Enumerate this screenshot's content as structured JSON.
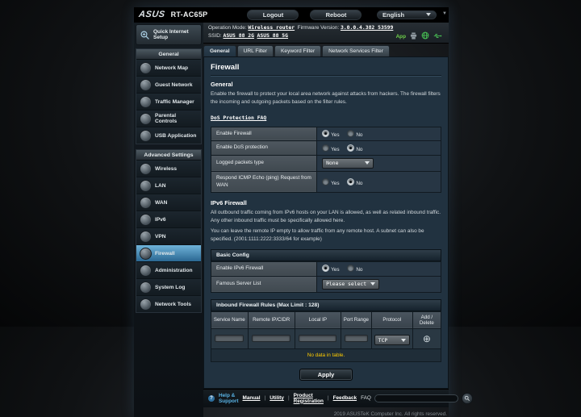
{
  "header": {
    "brand": "ASUS",
    "model": "RT-AC65P",
    "logout": "Logout",
    "reboot": "Reboot",
    "language": "English"
  },
  "infobar": {
    "operation_mode_label": "Operation Mode:",
    "operation_mode_value": "Wireless router",
    "firmware_label": "Firmware Version:",
    "firmware_value": "3.0.0.4.382_53599",
    "ssid_label": "SSID:",
    "ssid_2g": "ASUS_88_2G",
    "ssid_5g": "ASUS_88_5G",
    "app_badge": "App"
  },
  "tabs": [
    {
      "label": "General",
      "active": true
    },
    {
      "label": "URL Filter",
      "active": false
    },
    {
      "label": "Keyword Filter",
      "active": false
    },
    {
      "label": "Network Services Filter",
      "active": false
    }
  ],
  "sidebar": {
    "qis_label": "Quick Internet Setup",
    "sections": [
      {
        "title": "General",
        "items": [
          {
            "label": "Network Map"
          },
          {
            "label": "Guest Network"
          },
          {
            "label": "Traffic Manager"
          },
          {
            "label": "Parental Controls"
          },
          {
            "label": "USB Application"
          }
        ]
      },
      {
        "title": "Advanced Settings",
        "items": [
          {
            "label": "Wireless"
          },
          {
            "label": "LAN"
          },
          {
            "label": "WAN"
          },
          {
            "label": "IPv6"
          },
          {
            "label": "VPN"
          },
          {
            "label": "Firewall",
            "active": true
          },
          {
            "label": "Administration"
          },
          {
            "label": "System Log"
          },
          {
            "label": "Network Tools"
          }
        ]
      }
    ]
  },
  "main": {
    "page_title": "Firewall",
    "general_heading": "General",
    "general_desc": "Enable the firewall to protect your local area network against attacks from hackers. The firewall filters the incoming and outgoing packets based on the filter rules.",
    "faq_link": "DoS Protection FAQ",
    "rows": [
      {
        "label": "Enable Firewall",
        "yes": "Yes",
        "no": "No",
        "value": "Yes"
      },
      {
        "label": "Enable DoS protection",
        "yes": "Yes",
        "no": "No",
        "value": "No"
      },
      {
        "label": "Logged packets type",
        "value": "None"
      },
      {
        "label": "Respond ICMP Echo (ping) Request from WAN",
        "yes": "Yes",
        "no": "No",
        "value": "No"
      }
    ],
    "ipv6": {
      "heading": "IPv6 Firewall",
      "desc1": "All outbound traffic coming from IPv6 hosts on your LAN is allowed, as well as related inbound traffic. Any other inbound traffic must be specifically allowed here.",
      "desc2": "You can leave the remote IP empty to allow traffic from any remote host. A subnet can also be specified. (2001:1111:2222:3333/64 for example)"
    },
    "basic_config": {
      "heading": "Basic Config",
      "rows": [
        {
          "label": "Enable IPv6 Firewall",
          "yes": "Yes",
          "no": "No",
          "value": "Yes"
        },
        {
          "label": "Famous Server List",
          "value": "Please select"
        }
      ]
    },
    "inbound": {
      "heading": "Inbound Firewall Rules (Max Limit : 128)",
      "columns": [
        "Service Name",
        "Remote IP/CIDR",
        "Local IP",
        "Port Range",
        "Protocol",
        "Add / Delete"
      ],
      "protocol_value": "TCP",
      "empty_text": "No data in table.",
      "add_icon": "⊕"
    },
    "apply_label": "Apply"
  },
  "footer": {
    "help": "Help & Support",
    "links": [
      "Manual",
      "Utility",
      "Product Registration",
      "Feedback"
    ],
    "faq_label": "FAQ",
    "copyright": "2019 ASUSTeK Computer Inc. All rights reserved."
  },
  "colors": {
    "active_sidebar_item": "#3e86b4",
    "warning_text": "#ffcc00",
    "help_link_blue": "#58b2e4",
    "status_icon_green": "#49c455",
    "panel_background": "#213240"
  }
}
